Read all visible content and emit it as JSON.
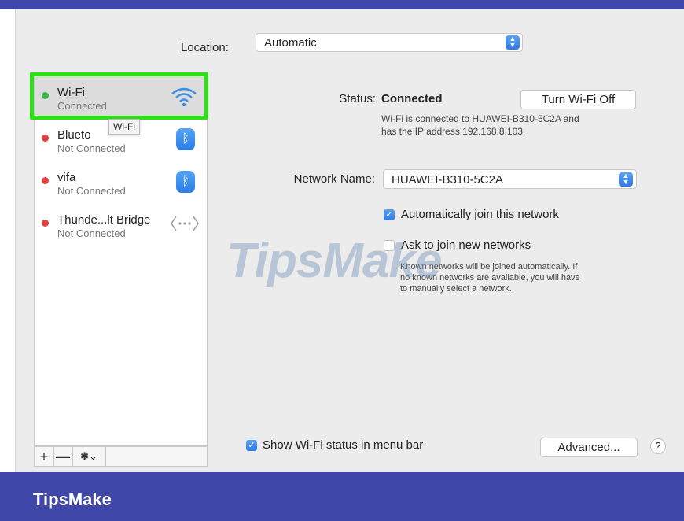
{
  "location": {
    "label": "Location:",
    "value": "Automatic"
  },
  "sidebar": {
    "items": [
      {
        "name": "Wi-Fi",
        "state": "Connected",
        "dot": "#3cb44b",
        "icon": "wifi-icon"
      },
      {
        "name": "Blueto",
        "state": "Not Connected",
        "dot": "#e0413d",
        "icon": "bluetooth-icon"
      },
      {
        "name": "vifa",
        "state": "Not Connected",
        "dot": "#e0413d",
        "icon": "bluetooth-icon"
      },
      {
        "name": "Thunde...lt Bridge",
        "state": "Not Connected",
        "dot": "#e0413d",
        "icon": "thunderbolt-bridge-icon"
      }
    ],
    "tooltip": "Wi-Fi",
    "toolbar": {
      "add": "+",
      "remove": "—",
      "gear": "✱⌄"
    }
  },
  "panel": {
    "status_label": "Status:",
    "status_value": "Connected",
    "turn_off_button": "Turn Wi-Fi Off",
    "status_desc_line1": "Wi-Fi is connected to HUAWEI-B310-5C2A and",
    "status_desc_line2": "has the IP address 192.168.8.103.",
    "network_name_label": "Network Name:",
    "network_name_value": "HUAWEI-B310-5C2A",
    "auto_join_label": "Automatically join this network",
    "ask_join_label": "Ask to join new networks",
    "hint_line1": "Known networks will be joined automatically. If",
    "hint_line2": "no known networks are available, you will have",
    "hint_line3": "to manually select a network.",
    "show_status_label": "Show Wi-Fi status in menu bar",
    "advanced_button": "Advanced...",
    "help_button": "?",
    "auto_join_checked": true,
    "ask_join_checked": false,
    "show_status_checked": true
  },
  "watermark": "TipsMake",
  "footer": {
    "brand": "TipsMake"
  },
  "colors": {
    "accent": "#2f7ae5",
    "highlight": "#2ee017",
    "brand_bar": "#3f48a8"
  }
}
